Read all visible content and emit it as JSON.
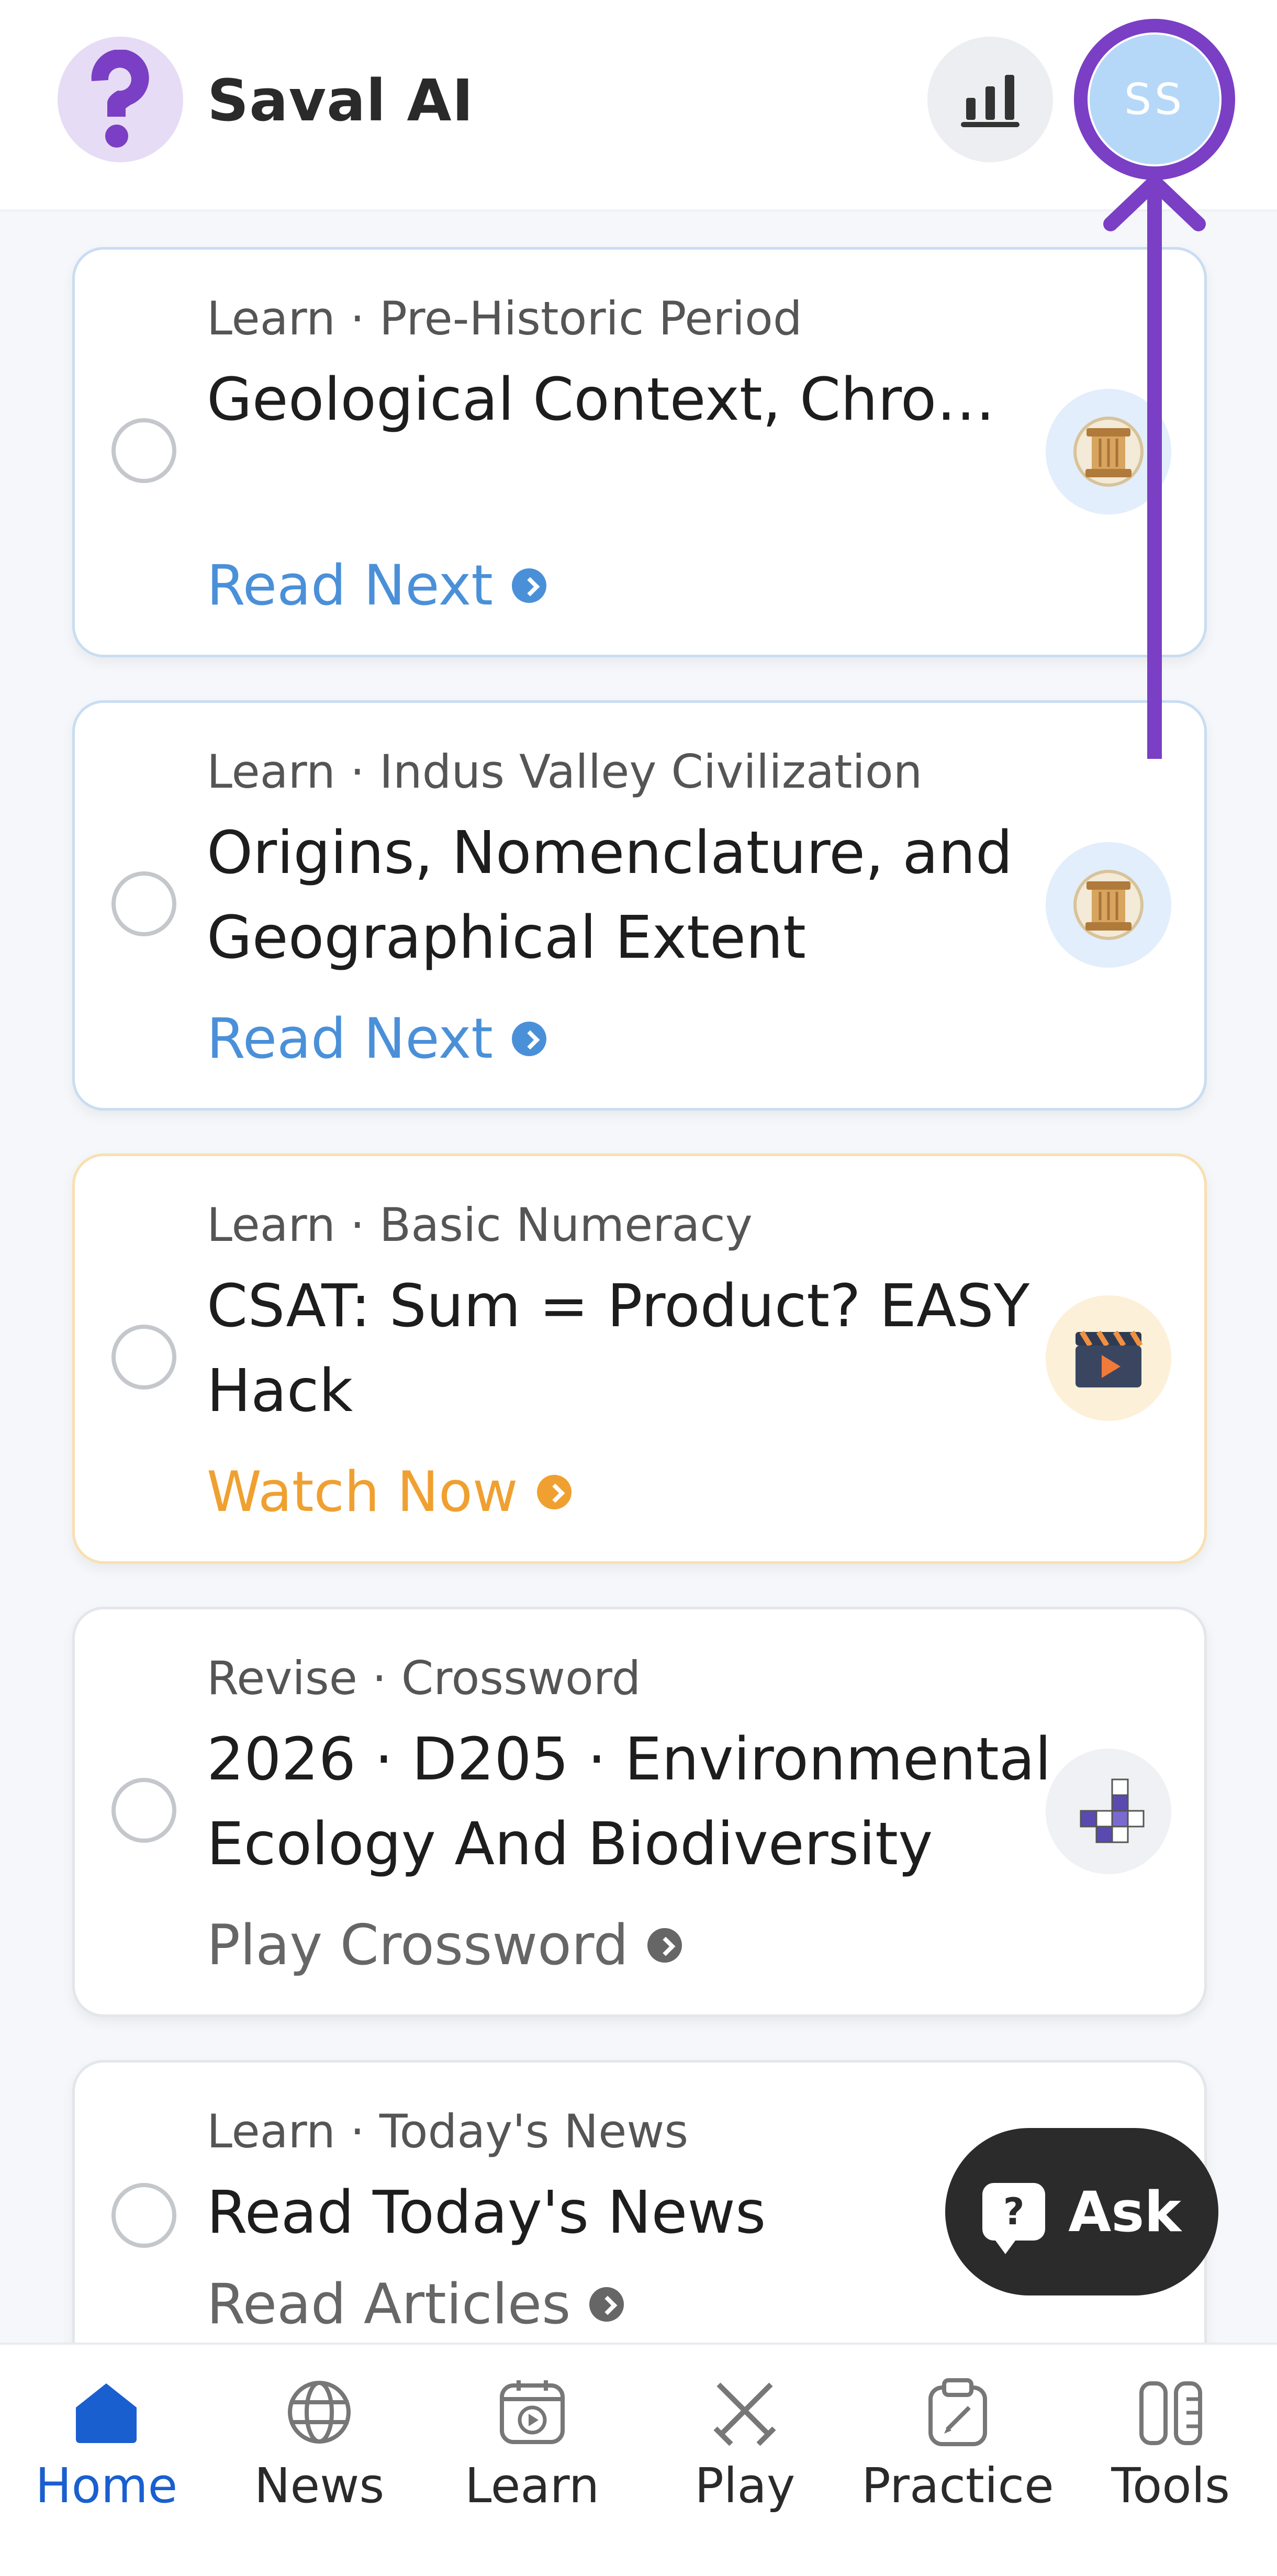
{
  "app": {
    "brand": "Saval AI",
    "avatar_initials": "SS"
  },
  "cards": [
    {
      "meta": "Learn · Pre-Historic Period",
      "title": "Geological Context, Chronology, and Early Hu...",
      "action": "Read Next",
      "badge_icon": "pillar-icon",
      "accent": "#4a90d9"
    },
    {
      "meta": "Learn · Indus Valley Civilization",
      "title": "Origins, Nomenclature, and Geographical Extent",
      "action": "Read Next",
      "badge_icon": "pillar-icon",
      "accent": "#4a90d9"
    },
    {
      "meta": "Learn · Basic Numeracy",
      "title": "CSAT: Sum = Product? EASY Hack",
      "action": "Watch Now",
      "badge_icon": "clapperboard-icon",
      "accent": "#f0a030"
    },
    {
      "meta": "Revise · Crossword",
      "title": "2026 · D205 · Environmental Ecology And Biodiversity",
      "action": "Play Crossword",
      "badge_icon": "crossword-icon",
      "accent": "#666666"
    },
    {
      "meta": "Learn · Today's News",
      "title": "Read Today's News",
      "action": "Read Articles",
      "badge_icon": "",
      "accent": "#666666"
    }
  ],
  "ask_button": {
    "label": "Ask"
  },
  "bottom_nav": [
    {
      "label": "Home",
      "icon": "home-icon",
      "active": true
    },
    {
      "label": "News",
      "icon": "globe-icon",
      "active": false
    },
    {
      "label": "Learn",
      "icon": "video-calendar-icon",
      "active": false
    },
    {
      "label": "Play",
      "icon": "swords-icon",
      "active": false
    },
    {
      "label": "Practice",
      "icon": "clipboard-pencil-icon",
      "active": false
    },
    {
      "label": "Tools",
      "icon": "tools-icon",
      "active": false
    }
  ],
  "colors": {
    "brand_purple": "#7a3fc4",
    "active_blue": "#1a5fd0",
    "link_blue": "#4a90d9",
    "watch_orange": "#f0a030"
  }
}
